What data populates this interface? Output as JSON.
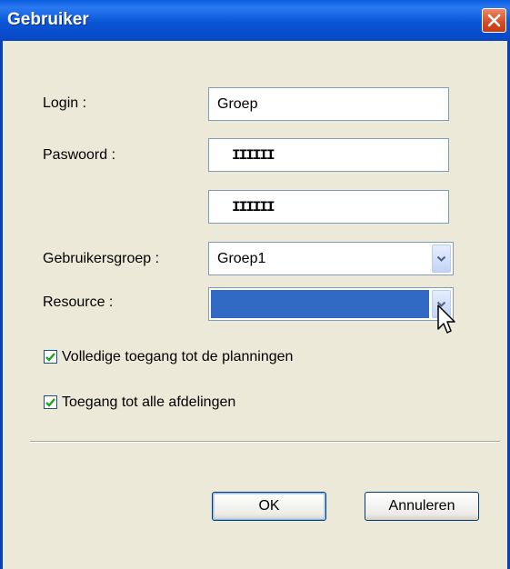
{
  "window": {
    "title": "Gebruiker"
  },
  "form": {
    "login_label": "Login :",
    "login_value": "Groep",
    "password_label": "Paswoord :",
    "password_mask": "IIIIII",
    "password_confirm_mask": "IIIIII",
    "group_label": "Gebruikersgroep :",
    "group_value": "Groep1",
    "resource_label": "Resource :",
    "resource_value": ""
  },
  "options": {
    "full_access_label": "Volledige toegang tot de planningen",
    "full_access_checked": true,
    "all_departments_label": "Toegang tot alle afdelingen",
    "all_departments_checked": true
  },
  "buttons": {
    "ok_label": "OK",
    "cancel_label": "Annuleren"
  },
  "colors": {
    "titlebar": "#0a56d6",
    "dialog_bg": "#ece9d8",
    "selection": "#316ac5",
    "check": "#21a121"
  }
}
